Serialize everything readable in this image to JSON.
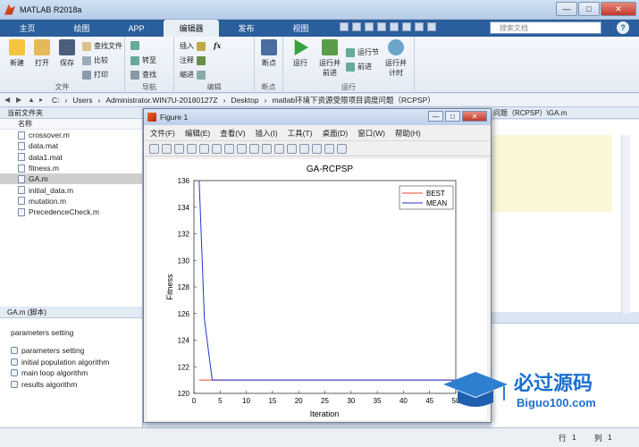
{
  "window": {
    "title": "MATLAB R2018a",
    "minimize": "—",
    "maximize": "□",
    "close": "✕"
  },
  "tabs": [
    {
      "label": "主页"
    },
    {
      "label": "绘图"
    },
    {
      "label": "APP"
    },
    {
      "label": "编辑器"
    },
    {
      "label": "发布"
    },
    {
      "label": "视图"
    }
  ],
  "search": {
    "placeholder": "搜索文档"
  },
  "toolstrip": {
    "file": {
      "group": "文件",
      "new": "新建",
      "open": "打开",
      "save": "保存",
      "find_files": "查找文件",
      "compare": "比较",
      "print": "打印"
    },
    "navigate": {
      "group": "导航",
      "goto": "转至",
      "find": "查找"
    },
    "edit": {
      "group": "编辑",
      "insert": "插入",
      "comment": "注释",
      "indent": "缩进",
      "fx": "fx"
    },
    "breakpoints": {
      "group": "断点",
      "label": "断点"
    },
    "run": {
      "group": "运行",
      "run": "运行",
      "run_advance": "运行并\n前进",
      "run_section": "运行节",
      "advance": "前进",
      "run_time": "运行并\n计时"
    }
  },
  "address": [
    "C:",
    "Users",
    "Administrator.WIN7U-20180127Z",
    "Desktop",
    "matlab环境下资源受限项目调度问题（RCPSP）"
  ],
  "folder_panel": {
    "header": "当前文件夹",
    "col_name": "名称",
    "files": [
      "crossover.m",
      "data.mat",
      "data1.mat",
      "fitness.m",
      "GA.m",
      "initial_data.m",
      "mutation.m",
      "PrecedenceCheck.m"
    ],
    "selected": "GA.m"
  },
  "details": {
    "header": "GA.m  (脚本)",
    "title": "parameters setting",
    "sections": [
      "parameters setting",
      "initial population algorithm",
      "main loop algorithm",
      "results algorithm"
    ]
  },
  "editor": {
    "tab_path": "问题（RCPSP）\\GA.m"
  },
  "status": {
    "row_label": "行",
    "row": "1",
    "col_label": "列",
    "col": "1"
  },
  "figure": {
    "title": "Figure 1",
    "menu": [
      "文件(F)",
      "编辑(E)",
      "查看(V)",
      "插入(I)",
      "工具(T)",
      "桌面(D)",
      "窗口(W)",
      "帮助(H)"
    ]
  },
  "watermark": {
    "brand": "必过源码",
    "url": "Biguo100.com"
  },
  "chart_data": {
    "type": "line",
    "title": "GA-RCPSP",
    "xlabel": "Iteration",
    "ylabel": "Fitness",
    "xlim": [
      0,
      50
    ],
    "ylim": [
      120,
      136
    ],
    "xticks": [
      0,
      5,
      10,
      15,
      20,
      25,
      30,
      35,
      40,
      45,
      50
    ],
    "yticks": [
      120,
      122,
      124,
      126,
      128,
      130,
      132,
      134,
      136
    ],
    "legend_position": "top-right",
    "series": [
      {
        "name": "BEST",
        "color": "#e8452c",
        "x": [
          1,
          2,
          3,
          50
        ],
        "y": [
          121,
          121,
          121,
          121
        ]
      },
      {
        "name": "MEAN",
        "color": "#2233cc",
        "x": [
          1,
          2,
          3,
          3.5,
          50
        ],
        "y": [
          136,
          125.6,
          122.5,
          121,
          121
        ]
      }
    ]
  }
}
